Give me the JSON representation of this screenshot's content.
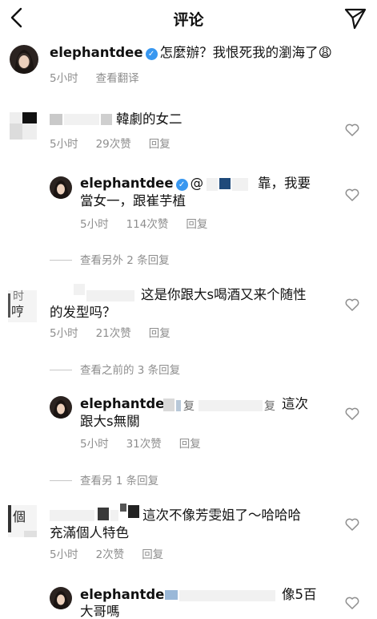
{
  "header": {
    "title": "评论",
    "back_icon": "chevron-left-icon",
    "send_icon": "paper-plane-icon"
  },
  "caption": {
    "username": "elephantdee",
    "text": "怎麼辦？我恨死我的瀏海了😩",
    "time": "5小时",
    "translate": "查看翻译"
  },
  "comments": [
    {
      "text": "韓劇的女二",
      "time": "5小时",
      "likes": "29次赞",
      "reply": "回复",
      "replies": [
        {
          "username": "elephantdee",
          "mention": "@",
          "text_line1": "靠，我要",
          "text_line2": "當女一，跟崔芋植",
          "time": "5小时",
          "likes": "114次赞",
          "reply": "回复"
        }
      ],
      "view_more": "查看另外 2 条回复"
    },
    {
      "text_line1": "这是你跟大s喝酒又来个随性",
      "text_line2": "的发型吗？",
      "time": "5小时",
      "likes": "21次赞",
      "reply": "回复",
      "view_previous": "查看之前的 3 条回复",
      "replies": [
        {
          "username": "elephantdee",
          "text_line1": "這次",
          "text_line2": "跟大s無關",
          "time": "5小时",
          "likes": "31次赞",
          "reply": "回复"
        }
      ],
      "view_more": "查看另 1 条回复"
    },
    {
      "text_line1": "這次不像芳雯姐了～哈哈哈",
      "text_line2": "充滿個人特色",
      "time": "5小时",
      "likes": "2次赞",
      "reply": "回复",
      "replies": [
        {
          "username": "elephantdee",
          "text_line1": "像5百",
          "text_line2": "大哥嗎"
        }
      ]
    }
  ],
  "partial_text": {
    "c2_avatar_a": "时",
    "c2_avatar_b": "哼",
    "c3_avatar": "個",
    "r2_fragment_a": "复",
    "r2_fragment_b": "复"
  },
  "colors": {
    "verified": "#3897f0",
    "meta_gray": "#8e8e8e",
    "text": "#111111"
  }
}
